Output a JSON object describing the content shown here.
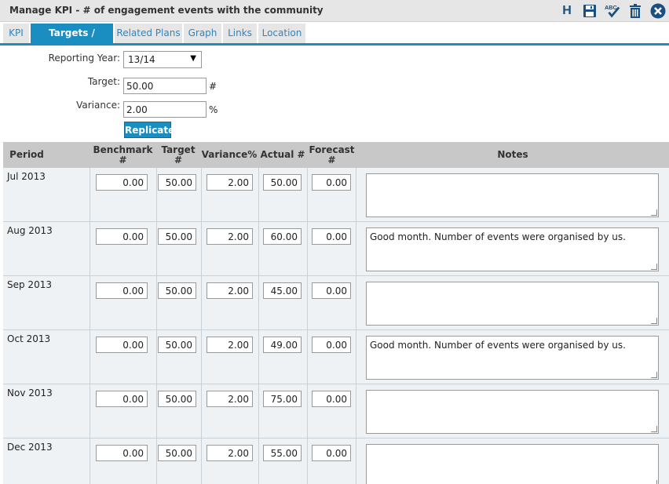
{
  "window": {
    "title": "Manage KPI - # of engagement events with the community",
    "toolbar": {
      "h_label": "H",
      "icons": [
        "save-icon",
        "spellcheck-icon",
        "delete-icon",
        "close-icon"
      ],
      "spell_label": "ABC"
    }
  },
  "tabs": [
    {
      "label": "KPI",
      "active": false
    },
    {
      "label": "Targets / Actuals",
      "active": true
    },
    {
      "label": "Related Plans",
      "active": false
    },
    {
      "label": "Graph",
      "active": false
    },
    {
      "label": "Links",
      "active": false
    },
    {
      "label": "Location",
      "active": false
    }
  ],
  "form": {
    "reporting_year_label": "Reporting Year:",
    "reporting_year_value": "13/14",
    "target_label": "Target:",
    "target_value": "50.00",
    "target_unit": "#",
    "variance_label": "Variance:",
    "variance_value": "2.00",
    "variance_unit": "%",
    "replicate_label": "Replicate"
  },
  "grid": {
    "headers": {
      "period": "Period",
      "benchmark": "Benchmark",
      "benchmark_unit": "#",
      "target": "Target",
      "target_unit": "#",
      "variance": "Variance%",
      "actual": "Actual #",
      "forecast": "Forecast",
      "forecast_unit": "#",
      "notes": "Notes"
    },
    "rows": [
      {
        "period": "Jul 2013",
        "benchmark": "0.00",
        "target": "50.00",
        "variance": "2.00",
        "actual": "50.00",
        "forecast": "0.00",
        "notes": ""
      },
      {
        "period": "Aug 2013",
        "benchmark": "0.00",
        "target": "50.00",
        "variance": "2.00",
        "actual": "60.00",
        "forecast": "0.00",
        "notes": "Good month. Number of events were organised by us."
      },
      {
        "period": "Sep 2013",
        "benchmark": "0.00",
        "target": "50.00",
        "variance": "2.00",
        "actual": "45.00",
        "forecast": "0.00",
        "notes": ""
      },
      {
        "period": "Oct 2013",
        "benchmark": "0.00",
        "target": "50.00",
        "variance": "2.00",
        "actual": "49.00",
        "forecast": "0.00",
        "notes": "Good month. Number of events were organised by us."
      },
      {
        "period": "Nov 2013",
        "benchmark": "0.00",
        "target": "50.00",
        "variance": "2.00",
        "actual": "75.00",
        "forecast": "0.00",
        "notes": ""
      },
      {
        "period": "Dec 2013",
        "benchmark": "0.00",
        "target": "50.00",
        "variance": "2.00",
        "actual": "55.00",
        "forecast": "0.00",
        "notes": ""
      }
    ]
  },
  "colors": {
    "accent": "#1a8dc1",
    "tab_text": "#2b86c5",
    "icon": "#1a4f7f",
    "row_bg": "#eef2f5",
    "header_bg": "#c8c8c8"
  }
}
